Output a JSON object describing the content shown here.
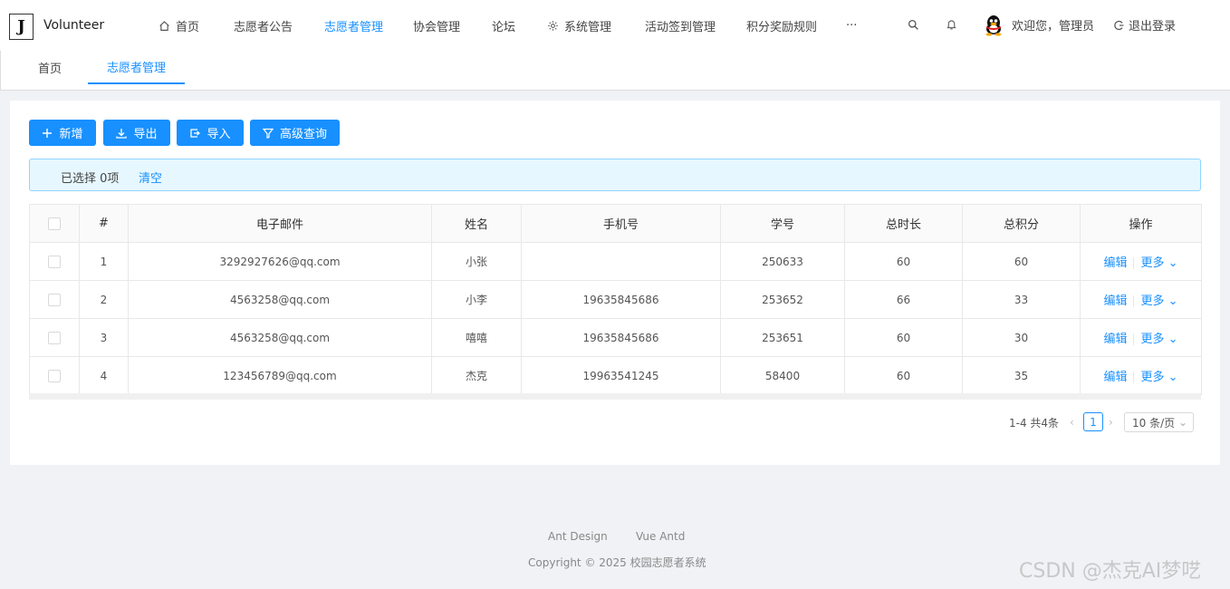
{
  "header": {
    "logo_letter": "J",
    "app_name": "Volunteer",
    "nav": [
      {
        "label": "首页",
        "icon": "home-icon"
      },
      {
        "label": "志愿者公告"
      },
      {
        "label": "志愿者管理",
        "active": true
      },
      {
        "label": "协会管理"
      },
      {
        "label": "论坛"
      },
      {
        "label": "系统管理",
        "icon": "gear-icon"
      },
      {
        "label": "活动签到管理"
      },
      {
        "label": "积分奖励规则"
      },
      {
        "label": "···"
      }
    ],
    "welcome": "欢迎您，管理员",
    "logout": "退出登录"
  },
  "tabs": [
    {
      "label": "首页"
    },
    {
      "label": "志愿者管理",
      "active": true
    }
  ],
  "toolbar": {
    "add": "新增",
    "export": "导出",
    "import": "导入",
    "advanced": "高级查询"
  },
  "alert": {
    "selected": "已选择 0项",
    "clear": "清空"
  },
  "table": {
    "headers": [
      "#",
      "电子邮件",
      "姓名",
      "手机号",
      "学号",
      "总时长",
      "总积分",
      "操作"
    ],
    "rows": [
      {
        "index": "1",
        "email": "3292927626@qq.com",
        "name": "小张",
        "phone": "",
        "student_id": "250633",
        "hours": "60",
        "points": "60"
      },
      {
        "index": "2",
        "email": "4563258@qq.com",
        "name": "小李",
        "phone": "19635845686",
        "student_id": "253652",
        "hours": "66",
        "points": "33"
      },
      {
        "index": "3",
        "email": "4563258@qq.com",
        "name": "嘻嘻",
        "phone": "19635845686",
        "student_id": "253651",
        "hours": "60",
        "points": "30"
      },
      {
        "index": "4",
        "email": "123456789@qq.com",
        "name": "杰克",
        "phone": "19963541245",
        "student_id": "58400",
        "hours": "60",
        "points": "35"
      }
    ],
    "edit_label": "编辑",
    "more_label": "更多"
  },
  "pagination": {
    "total": "1-4 共4条",
    "current_page": "1",
    "page_size": "10 条/页"
  },
  "footer": {
    "link1": "Ant Design",
    "link2": "Vue Antd",
    "copyright": "Copyright © 2025 校园志愿者系统"
  },
  "watermark": "CSDN @杰克AI梦呓",
  "colors": {
    "primary": "#1890ff",
    "alert_bg": "#e6f7ff",
    "page_bg": "#f0f2f5"
  }
}
